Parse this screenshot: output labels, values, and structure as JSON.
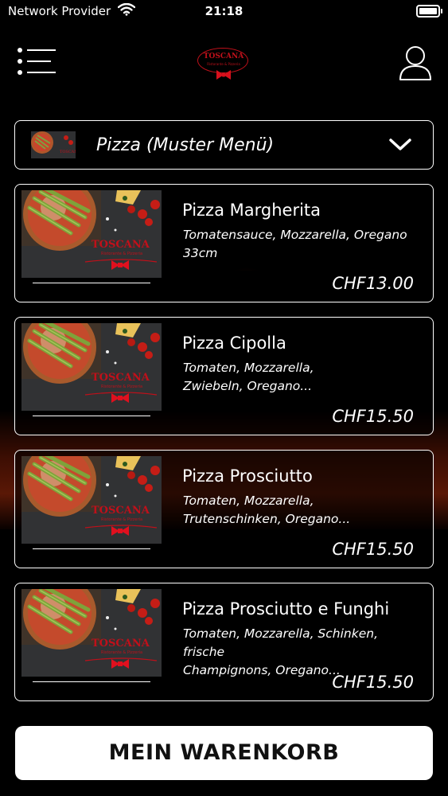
{
  "status_bar": {
    "carrier": "Network Provider",
    "time": "21:18"
  },
  "header": {
    "logo_name": "TOSCANA",
    "logo_subtitle": "Ristorante & Pizzeria",
    "menu_icon": "menu-list-icon",
    "user_icon": "user-icon"
  },
  "category": {
    "label": "Pizza (Muster Menü)",
    "icon": "chevron-down-icon"
  },
  "items": [
    {
      "title": "Pizza Margherita",
      "desc_line1": "Tomatensauce, Mozzarella, Oregano",
      "desc_line2": "33cm",
      "price": "CHF13.00"
    },
    {
      "title": "Pizza Cipolla",
      "desc_line1": "Tomaten, Mozzarella,",
      "desc_line2": "Zwiebeln, Oregano...",
      "price": "CHF15.50"
    },
    {
      "title": "Pizza Prosciutto",
      "desc_line1": "Tomaten, Mozzarella,",
      "desc_line2": "Trutenschinken, Oregano...",
      "price": "CHF15.50"
    },
    {
      "title": "Pizza Prosciutto e Funghi",
      "desc_line1": "Tomaten, Mozzarella, Schinken, frische",
      "desc_line2": "Champignons, Oregano...",
      "price": "CHF15.50"
    }
  ],
  "cart": {
    "label": "MEIN WARENKORB"
  },
  "colors": {
    "brand_red": "#c0101a",
    "background": "#000000",
    "button_bg": "#ffffff"
  }
}
